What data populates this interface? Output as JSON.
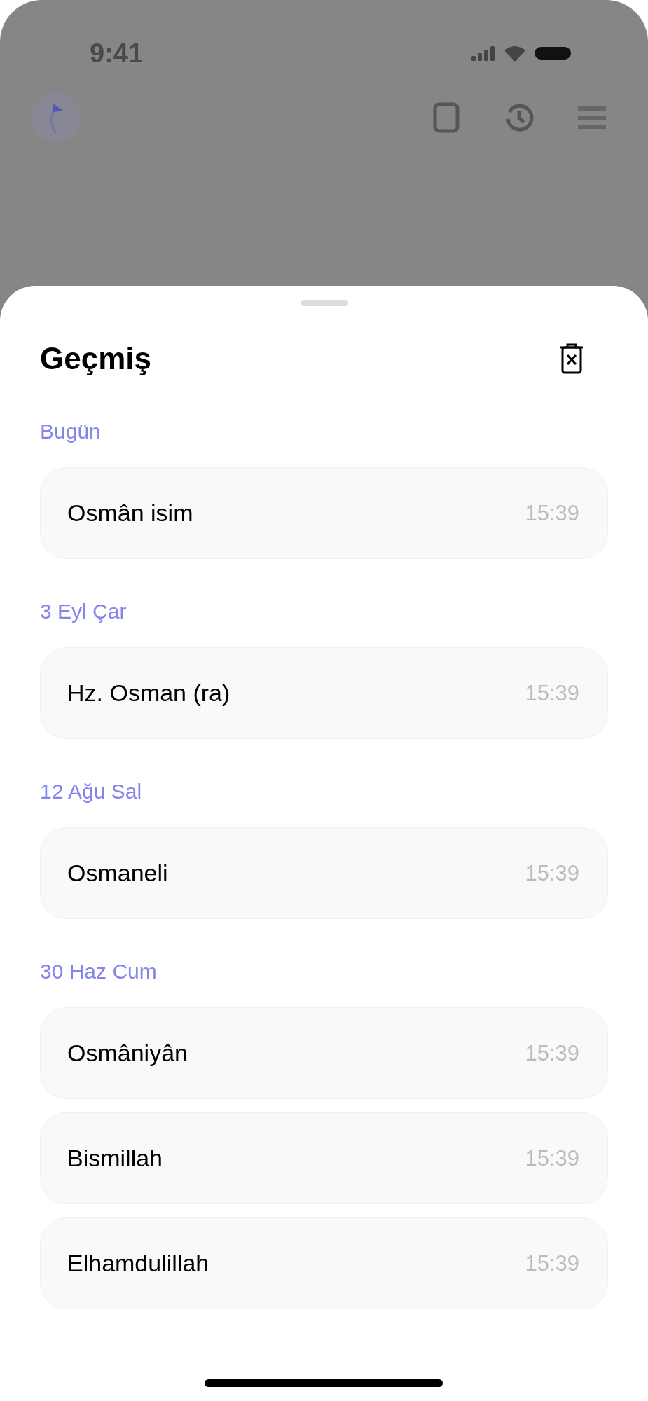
{
  "status_bar": {
    "time": "9:41"
  },
  "sheet": {
    "title": "Geçmiş",
    "groups": [
      {
        "label": "Bugün",
        "items": [
          {
            "text": "Osmân isim",
            "time": "15:39"
          }
        ]
      },
      {
        "label": "3 Eyl Çar",
        "items": [
          {
            "text": "Hz. Osman (ra)",
            "time": "15:39"
          }
        ]
      },
      {
        "label": "12 Ağu Sal",
        "items": [
          {
            "text": "Osmaneli",
            "time": "15:39"
          }
        ]
      },
      {
        "label": "30 Haz Cum",
        "items": [
          {
            "text": "Osmâniyân",
            "time": "15:39"
          },
          {
            "text": "Bismillah",
            "time": "15:39"
          },
          {
            "text": "Elhamdulillah",
            "time": "15:39"
          }
        ]
      }
    ]
  }
}
